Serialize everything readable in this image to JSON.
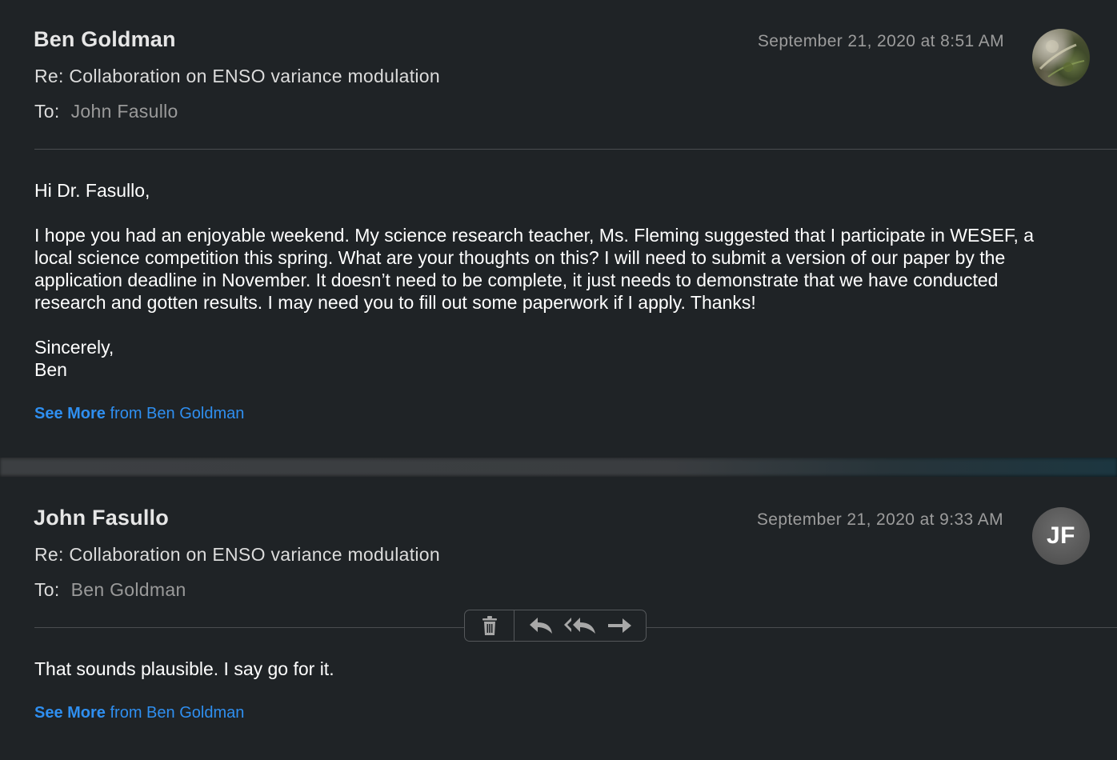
{
  "messages": [
    {
      "sender": "Ben Goldman",
      "subject": "Re: Collaboration on ENSO variance modulation",
      "to_label": "To:",
      "to": "John Fasullo",
      "date": "September 21, 2020 at 8:51 AM",
      "avatar": "photo-avatar",
      "body": {
        "greeting": "Hi Dr. Fasullo,",
        "paragraph": "I hope you had an enjoyable weekend. My science research teacher, Ms. Fleming suggested that I participate in WESEF, a local science competition this spring. What are your thoughts on this? I will need to submit a version of our paper by the application deadline in November. It doesn’t need to be complete, it just needs to demonstrate that we have conducted research and gotten results. I may need you to fill out some paperwork if I apply. Thanks!",
        "closing": "Sincerely,",
        "signature": "Ben"
      },
      "see_more": {
        "strong": "See More",
        "rest": " from Ben Goldman"
      }
    },
    {
      "sender": "John Fasullo",
      "subject": "Re: Collaboration on ENSO variance modulation",
      "to_label": "To:",
      "to": "Ben Goldman",
      "date": "September 21, 2020 at 9:33 AM",
      "avatar_initials": "JF",
      "body": {
        "paragraph": "That sounds plausible. I say go for it."
      },
      "see_more": {
        "strong": "See More",
        "rest": " from Ben Goldman"
      }
    }
  ],
  "toolbar": {
    "buttons": [
      "trash-icon",
      "reply-icon",
      "reply-all-icon",
      "forward-icon"
    ]
  },
  "colors": {
    "background": "#1f2326",
    "link": "#2f8ff0",
    "text": "#ffffff",
    "muted": "#9c9c9c"
  }
}
